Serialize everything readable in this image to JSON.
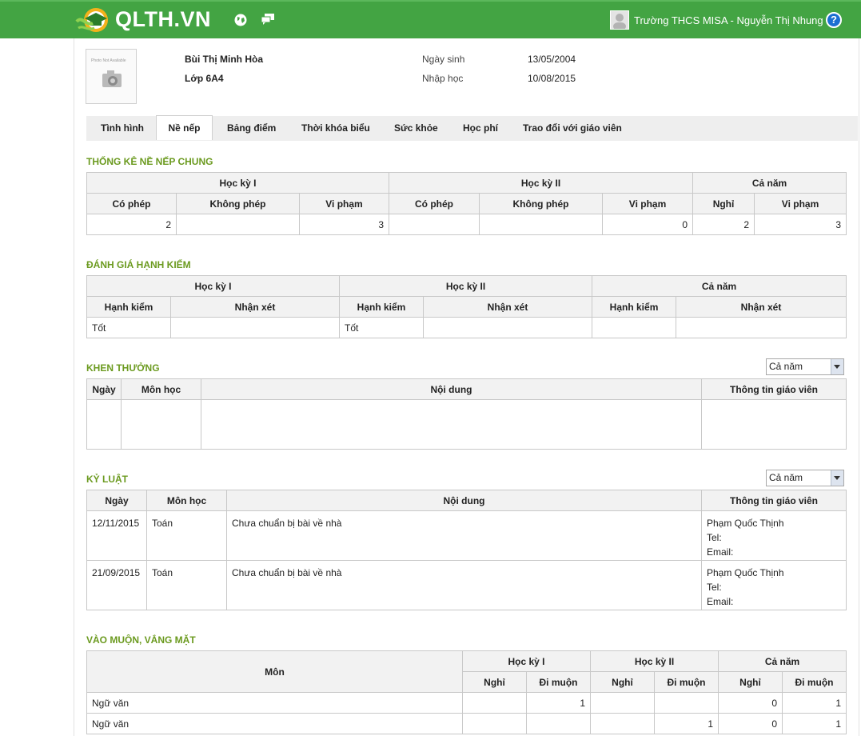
{
  "header": {
    "logo_text": "QLTH.VN",
    "user_label": "Trường THCS MISA - Nguyễn Thị Nhung",
    "help_label": "?",
    "colors": {
      "brand": "#43a443",
      "section_title": "#6b9a1f",
      "help": "#1b6fd1"
    }
  },
  "student": {
    "photo_caption": "Photo Not Available",
    "name": "Bùi Thị Minh Hòa",
    "class": "Lớp 6A4",
    "dob_label": "Ngày sinh",
    "dob": "13/05/2004",
    "enroll_label": "Nhập học",
    "enroll": "10/08/2015"
  },
  "tabs": [
    "Tình hình",
    "Nề nếp",
    "Bảng điểm",
    "Thời khóa biểu",
    "Sức khỏe",
    "Học phí",
    "Trao đổi với giáo viên"
  ],
  "active_tab": "Nề nếp",
  "discipline_stats": {
    "title": "THỐNG KÊ NỀ NẾP CHUNG",
    "groups": [
      "Học kỳ I",
      "Học kỳ II",
      "Cả năm"
    ],
    "cols": [
      "Có phép",
      "Không phép",
      "Vi phạm",
      "Có phép",
      "Không phép",
      "Vi phạm",
      "Nghỉ",
      "Vi phạm"
    ],
    "row": [
      "2",
      "",
      "3",
      "",
      "",
      "0",
      "2",
      "3"
    ]
  },
  "conduct": {
    "title": "ĐÁNH GIÁ HẠNH KIỂM",
    "groups": [
      "Học kỳ I",
      "Học kỳ II",
      "Cả năm"
    ],
    "cols": [
      "Hạnh kiểm",
      "Nhận xét",
      "Hạnh kiểm",
      "Nhận xét",
      "Hạnh kiểm",
      "Nhận xét"
    ],
    "row": [
      "Tốt",
      "",
      "Tốt",
      "",
      "",
      ""
    ]
  },
  "rewards": {
    "title": "KHEN THƯỞNG",
    "filter": "Cả năm",
    "cols": [
      "Ngày",
      "Môn học",
      "Nội dung",
      "Thông tin giáo viên"
    ]
  },
  "penalties": {
    "title": "KỶ LUẬT",
    "filter": "Cả năm",
    "cols": [
      "Ngày",
      "Môn học",
      "Nội dung",
      "Thông tin giáo viên"
    ],
    "rows": [
      {
        "date": "12/11/2015",
        "subject": "Toán",
        "content": "Chưa chuẩn bị bài về nhà",
        "teacher": "Phạm Quốc Thịnh",
        "tel": "Tel:",
        "email": "Email:"
      },
      {
        "date": "21/09/2015",
        "subject": "Toán",
        "content": "Chưa chuẩn bị bài về nhà",
        "teacher": "Phạm Quốc Thịnh",
        "tel": "Tel:",
        "email": "Email:"
      }
    ]
  },
  "attendance": {
    "title": "VÀO MUỘN, VẮNG MẶT",
    "subject_col": "Môn",
    "groups": [
      "Học kỳ I",
      "Học kỳ II",
      "Cả năm"
    ],
    "cols": [
      "Nghỉ",
      "Đi muộn",
      "Nghỉ",
      "Đi muộn",
      "Nghỉ",
      "Đi muộn"
    ],
    "rows": [
      {
        "subject": "Ngữ văn",
        "values": [
          "",
          "1",
          "",
          "",
          "0",
          "1"
        ]
      },
      {
        "subject": "Ngữ văn",
        "values": [
          "",
          "",
          "",
          "1",
          "0",
          "1"
        ]
      }
    ]
  }
}
